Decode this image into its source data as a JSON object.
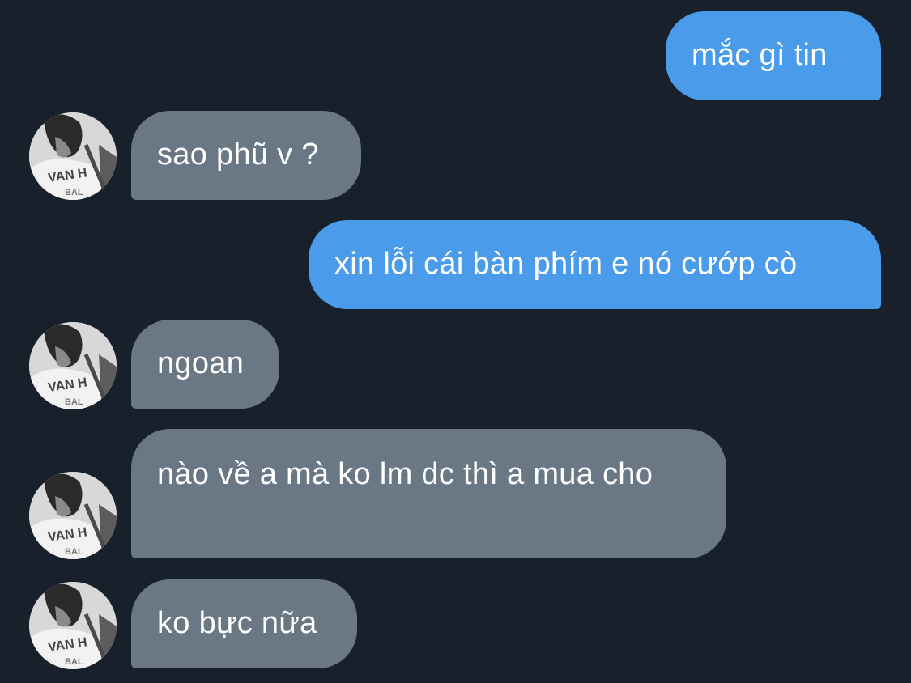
{
  "conversation": {
    "messages": [
      {
        "direction": "outgoing",
        "text": "mắc gì tin"
      },
      {
        "direction": "incoming",
        "text": "sao phũ v ?"
      },
      {
        "direction": "outgoing",
        "text": "xin lỗi cái bàn phím e nó cướp cò"
      },
      {
        "direction": "incoming",
        "text": "ngoan"
      },
      {
        "direction": "incoming",
        "text": "nào về a mà ko lm dc thì a mua cho"
      },
      {
        "direction": "incoming",
        "text": "ko bực nữa"
      }
    ]
  },
  "avatar": {
    "icon": "contact-avatar-photo",
    "shirt_text_line1": "VAN H",
    "shirt_text_line2": "BAL"
  },
  "colors": {
    "background": "#18202b",
    "outgoing_bubble": "#4a9be9",
    "incoming_bubble": "#6a7886",
    "text": "#ffffff"
  }
}
